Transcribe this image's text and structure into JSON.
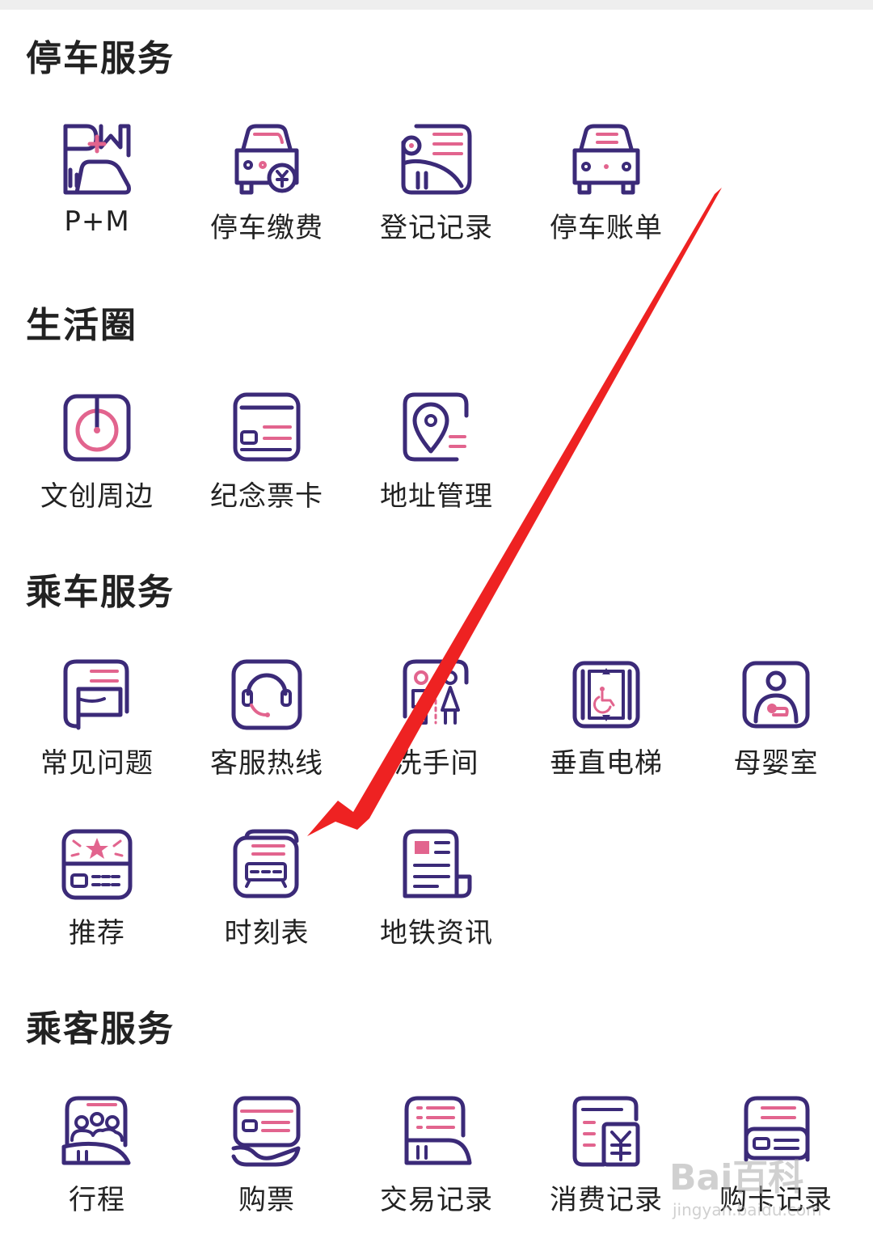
{
  "colors": {
    "primary": "#3b2a78",
    "accent": "#e2648e",
    "arrow": "#ee2222"
  },
  "sections": [
    {
      "title": "停车服务",
      "items": [
        {
          "label": "P+M",
          "icon": "p-plus-m-icon"
        },
        {
          "label": "停车缴费",
          "icon": "parking-payment-icon"
        },
        {
          "label": "登记记录",
          "icon": "registration-record-icon"
        },
        {
          "label": "停车账单",
          "icon": "parking-bill-icon"
        }
      ]
    },
    {
      "title": "生活圈",
      "items": [
        {
          "label": "文创周边",
          "icon": "cultural-products-icon"
        },
        {
          "label": "纪念票卡",
          "icon": "souvenir-card-icon"
        },
        {
          "label": "地址管理",
          "icon": "address-management-icon"
        }
      ]
    },
    {
      "title": "乘车服务",
      "items": [
        {
          "label": "常见问题",
          "icon": "faq-icon"
        },
        {
          "label": "客服热线",
          "icon": "customer-service-icon"
        },
        {
          "label": "洗手间",
          "icon": "restroom-icon"
        },
        {
          "label": "垂直电梯",
          "icon": "elevator-icon"
        },
        {
          "label": "母婴室",
          "icon": "nursing-room-icon"
        },
        {
          "label": "推荐",
          "icon": "recommend-icon"
        },
        {
          "label": "时刻表",
          "icon": "timetable-icon"
        },
        {
          "label": "地铁资讯",
          "icon": "metro-news-icon"
        }
      ]
    },
    {
      "title": "乘客服务",
      "items": [
        {
          "label": "行程",
          "icon": "trip-icon"
        },
        {
          "label": "购票",
          "icon": "buy-ticket-icon"
        },
        {
          "label": "交易记录",
          "icon": "transaction-record-icon"
        },
        {
          "label": "消费记录",
          "icon": "consumption-record-icon"
        },
        {
          "label": "购卡记录",
          "icon": "card-purchase-record-icon"
        }
      ]
    }
  ],
  "watermark": {
    "main": "Bai百科",
    "sub": "jingyan.baidu.com"
  }
}
